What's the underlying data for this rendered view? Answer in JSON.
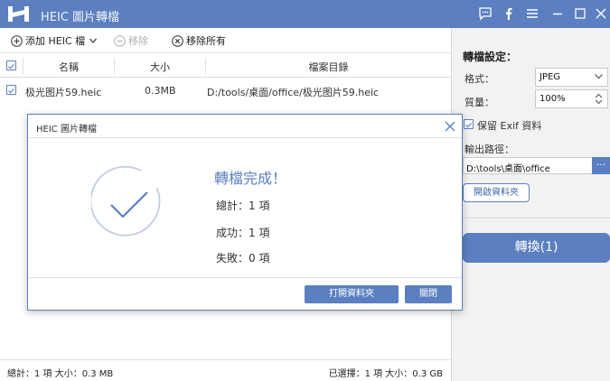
{
  "app": {
    "title": "HEIC 圖片轉檔"
  },
  "toolbar": {
    "add_label": "添加 HEIC 檔",
    "remove_label": "移除",
    "remove_all_label": "移除所有"
  },
  "table": {
    "headers": {
      "name": "名稱",
      "size": "大小",
      "dir": "檔案目錄"
    },
    "rows": [
      {
        "name": "极光图片59.heic",
        "size": "0.3MB",
        "dir": "D:/tools/桌面/office/极光图片59.heic",
        "checked": true
      }
    ]
  },
  "status": {
    "left": "總計：1 項 大小：0.3 MB",
    "right": "已選擇：1 項 大小：0.3 GB"
  },
  "settings": {
    "title": "轉檔設定：",
    "format_label": "格式：",
    "format_value": "JPEG",
    "quality_label": "質量：",
    "quality_value": "100%",
    "keep_exif_label": "保留 Exif 資料",
    "keep_exif_checked": true,
    "output_label": "輸出路徑：",
    "output_path": "D:\\tools\\桌面\\office",
    "browse_label": "···",
    "open_folder_label": "開啟資料夾",
    "convert_label": "轉換(1)"
  },
  "dialog": {
    "title": "HEIC 圖片轉檔",
    "heading": "轉檔完成！",
    "total": "總計：1 項",
    "success": "成功：1 項",
    "failed": "失敗：0 項",
    "open_button": "打開資料夾",
    "close_button": "關閉"
  },
  "colors": {
    "accent": "#5b7fc0",
    "titlebar": "#5b7fc0",
    "panel_bg": "#f2f2f2"
  }
}
